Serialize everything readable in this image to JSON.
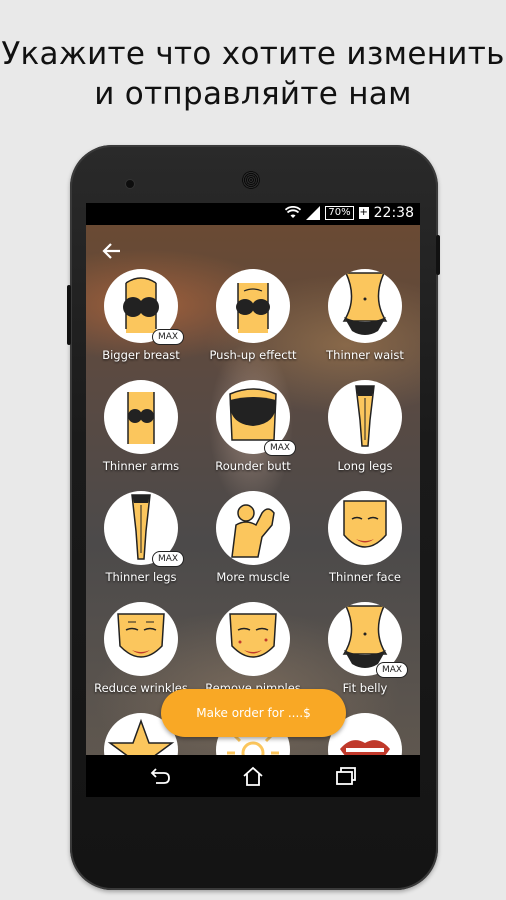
{
  "headline": {
    "line1": "Укажите что хотите изменить",
    "line2": "и отправляйте нам"
  },
  "status": {
    "battery": "70%",
    "time": "22:38",
    "icons": [
      "wifi-icon",
      "signal-icon",
      "battery-icon",
      "charging-icon"
    ]
  },
  "options": [
    {
      "label": "Bigger breast",
      "max": "MAX",
      "icon": "breast-icon"
    },
    {
      "label": "Push-up effectt",
      "icon": "push-up-icon"
    },
    {
      "label": "Thinner waist",
      "icon": "waist-icon"
    },
    {
      "label": "Thinner arms",
      "icon": "arms-icon"
    },
    {
      "label": "Rounder butt",
      "max": "MAX",
      "icon": "butt-icon"
    },
    {
      "label": "Long legs",
      "icon": "long-legs-icon"
    },
    {
      "label": "Thinner legs",
      "max": "MAX",
      "icon": "legs-icon"
    },
    {
      "label": "More muscle",
      "icon": "muscle-icon"
    },
    {
      "label": "Thinner face",
      "icon": "face-icon"
    },
    {
      "label": "Reduce wrinkles",
      "icon": "wrinkles-face-icon"
    },
    {
      "label": "Remove pimples",
      "icon": "pimples-face-icon"
    },
    {
      "label": "Fit belly",
      "max": "MAX",
      "icon": "belly-icon"
    },
    {
      "label": "",
      "icon": "star-icon"
    },
    {
      "label": "",
      "icon": "sun-icon"
    },
    {
      "label": "",
      "icon": "lips-icon"
    }
  ],
  "order_button": "Make order for ....$",
  "colors": {
    "accent": "#f9a825",
    "skin": "#fbc65d",
    "outline": "#222222"
  },
  "nav": {
    "back": "back-nav-icon",
    "home": "home-nav-icon",
    "recents": "recents-nav-icon"
  }
}
